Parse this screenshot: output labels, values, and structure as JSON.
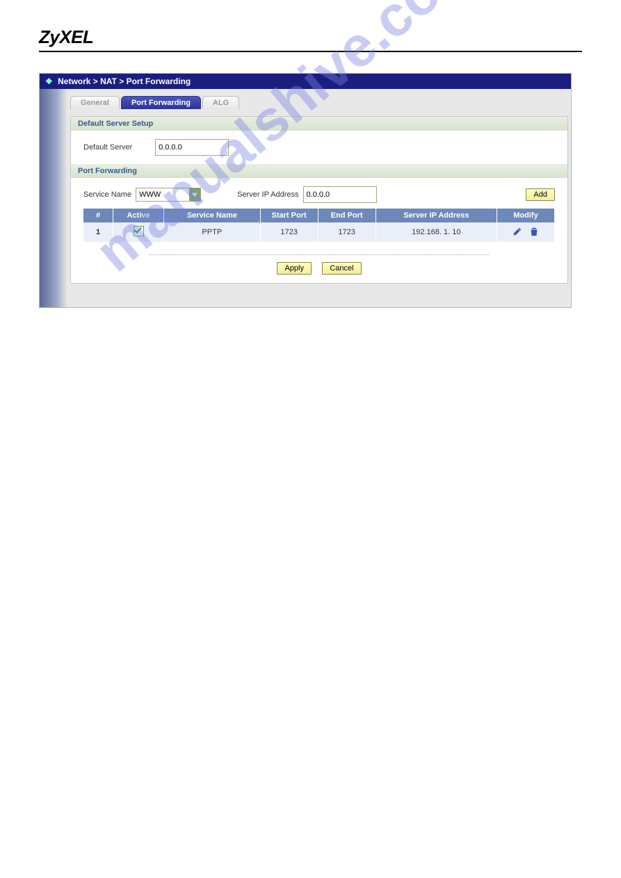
{
  "brand": "ZyXEL",
  "watermark": "manualshive.com",
  "breadcrumb": "Network > NAT > Port Forwarding",
  "tabs": {
    "general": "General",
    "port_forwarding": "Port Forwarding",
    "alg": "ALG"
  },
  "sections": {
    "default_server": {
      "title": "Default Server Setup",
      "label": "Default Server",
      "value": "0.0.0.0"
    },
    "port_forwarding": {
      "title": "Port Forwarding",
      "service_name_label": "Service Name",
      "service_name_value": "WWW",
      "server_ip_label": "Server IP Address",
      "server_ip_value": "0.0.0.0",
      "add_label": "Add",
      "columns": {
        "num": "#",
        "active": "Active",
        "service": "Service Name",
        "start": "Start Port",
        "end": "End Port",
        "ip": "Server IP Address",
        "modify": "Modify"
      },
      "rows": [
        {
          "num": "1",
          "active": true,
          "service": "PPTP",
          "start": "1723",
          "end": "1723",
          "ip": "192.168. 1. 10"
        }
      ]
    }
  },
  "buttons": {
    "apply": "Apply",
    "cancel": "Cancel"
  }
}
